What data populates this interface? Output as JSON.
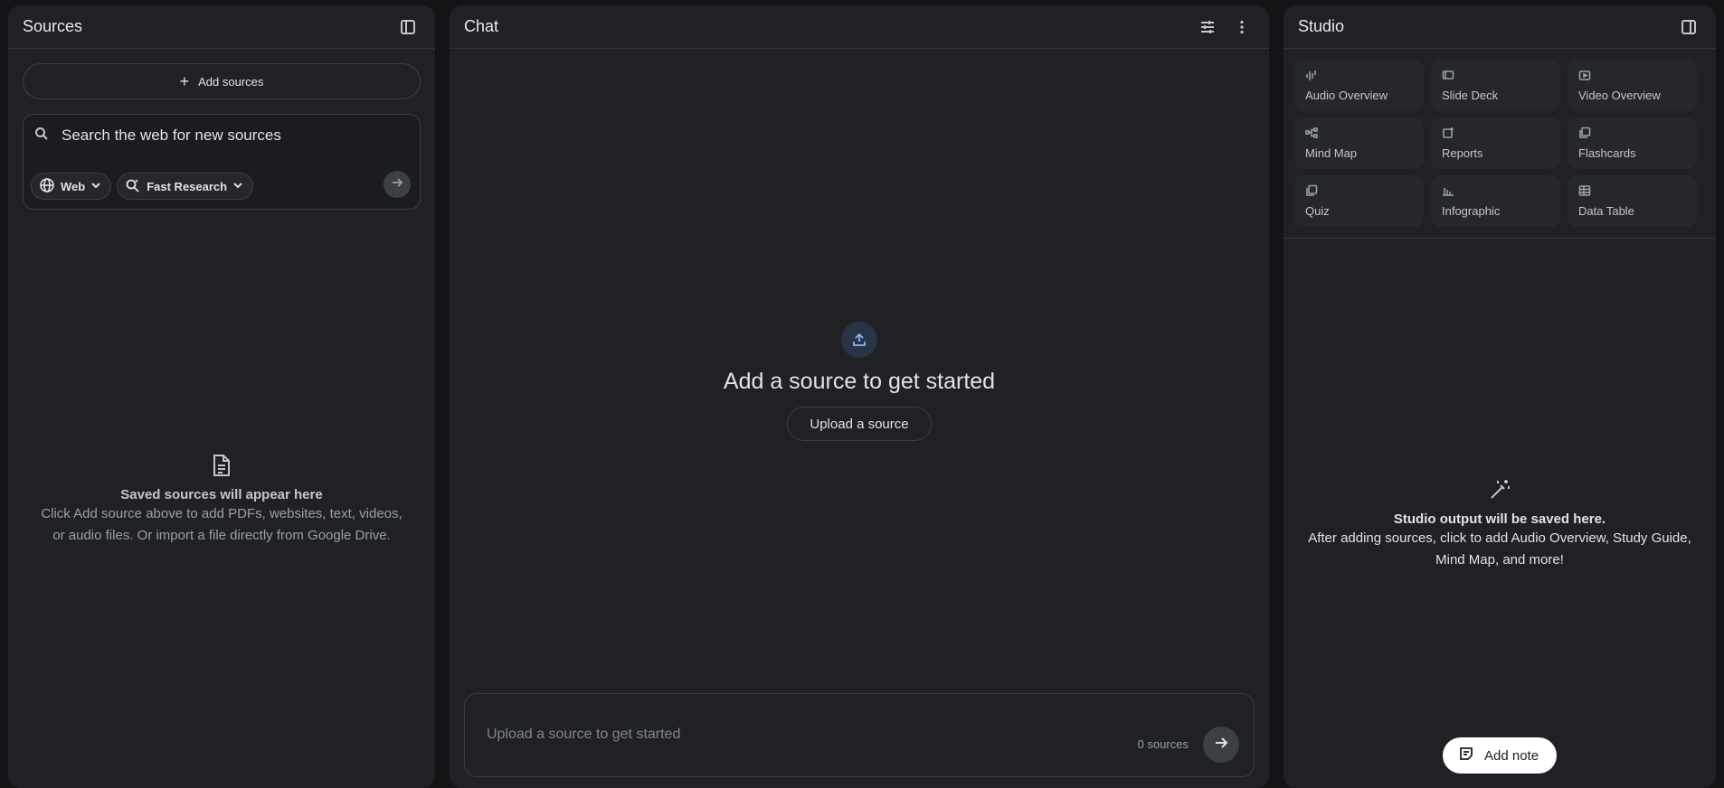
{
  "sources": {
    "title": "Sources",
    "add_sources_label": "Add sources",
    "search": {
      "placeholder": "Search the web for new sources"
    },
    "web_chip": "Web",
    "research_chip": "Fast Research",
    "empty_title": "Saved sources will appear here",
    "empty_desc": "Click Add source above to add PDFs, websites, text, videos, or audio files. Or import a file directly from Google Drive."
  },
  "chat": {
    "title": "Chat",
    "empty_title": "Add a source to get started",
    "upload_label": "Upload a source",
    "input_placeholder": "Upload a source to get started",
    "source_count": "0 sources"
  },
  "studio": {
    "title": "Studio",
    "tools": [
      {
        "label": "Audio Overview",
        "icon": "audio-wave-icon"
      },
      {
        "label": "Slide Deck",
        "icon": "slides-icon"
      },
      {
        "label": "Video Overview",
        "icon": "video-icon"
      },
      {
        "label": "Mind Map",
        "icon": "mind-map-icon"
      },
      {
        "label": "Reports",
        "icon": "reports-icon"
      },
      {
        "label": "Flashcards",
        "icon": "flashcards-icon"
      },
      {
        "label": "Quiz",
        "icon": "quiz-icon"
      },
      {
        "label": "Infographic",
        "icon": "infographic-icon"
      },
      {
        "label": "Data Table",
        "icon": "table-icon"
      }
    ],
    "empty_title": "Studio output will be saved here.",
    "empty_desc": "After adding sources, click to add Audio Overview, Study Guide, Mind Map, and more!",
    "add_note_label": "Add note"
  },
  "colors": {
    "background": "#131416",
    "panel": "#202124",
    "accent_blue": "#8ab4f8"
  }
}
